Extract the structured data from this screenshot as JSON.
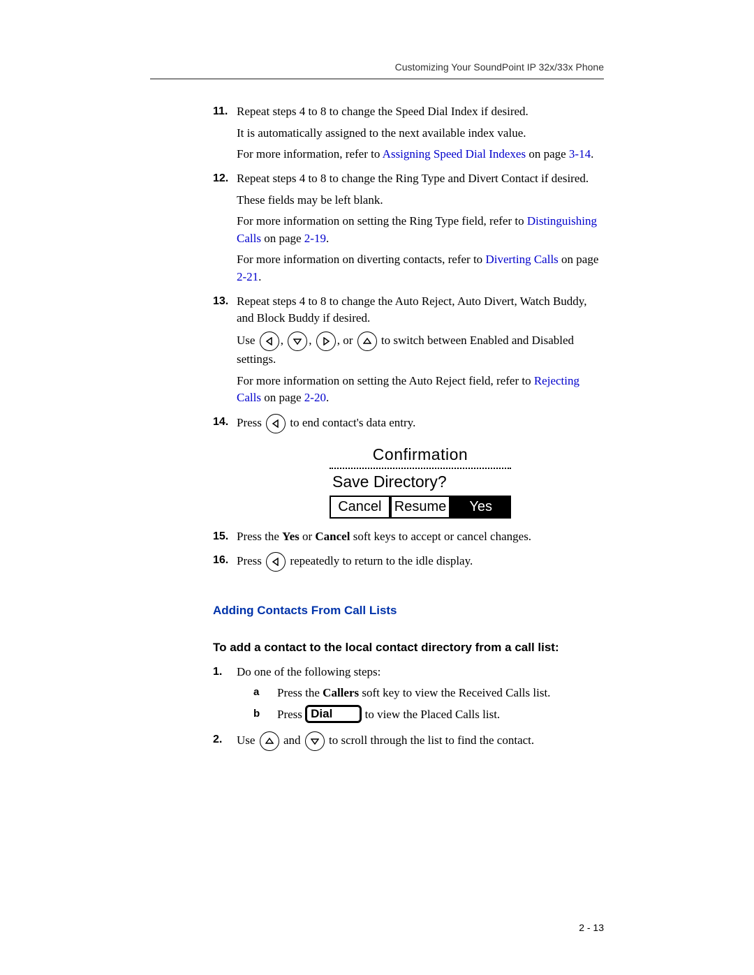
{
  "header": "Customizing Your SoundPoint IP 32x/33x Phone",
  "page_number": "2 - 13",
  "steps": {
    "s11": {
      "num": "11.",
      "p1": "Repeat steps 4 to 8 to change the Speed Dial Index if desired.",
      "p2": "It is automatically assigned to the next available index value.",
      "p3a": "For more information, refer to ",
      "link1": "Assigning Speed Dial Indexes",
      "p3b": " on page ",
      "link1page": "3-14",
      "p3c": "."
    },
    "s12": {
      "num": "12.",
      "p1": "Repeat steps 4 to 8 to change the Ring Type and Divert Contact if desired.",
      "p2": "These fields may be left blank.",
      "p3a": "For more information on setting the Ring Type field, refer to ",
      "link1": "Distinguishing Calls",
      "p3b": " on page ",
      "link1page": "2-19",
      "p3c": ".",
      "p4a": "For more information on diverting contacts, refer to ",
      "link2": "Diverting Calls",
      "p4b": " on page ",
      "link2page": "2-21",
      "p4c": "."
    },
    "s13": {
      "num": "13.",
      "p1": "Repeat steps 4 to 8 to change the Auto Reject, Auto Divert, Watch Buddy, and Block Buddy if desired.",
      "p2a": "Use ",
      "p2b": ", ",
      "p2c": ", ",
      "p2d": ", or ",
      "p2e": " to switch between Enabled and Disabled settings.",
      "p3a": "For more information on setting the Auto Reject field, refer to ",
      "link1": "Rejecting Calls",
      "p3b": " on page ",
      "link1page": "2-20",
      "p3c": "."
    },
    "s14": {
      "num": "14.",
      "p1a": "Press ",
      "p1b": " to end contact's data entry."
    },
    "s15": {
      "num": "15.",
      "p1a": "Press the ",
      "yes": "Yes",
      "p1b": " or ",
      "cancel": "Cancel",
      "p1c": " soft keys to accept or cancel changes."
    },
    "s16": {
      "num": "16.",
      "p1a": "Press ",
      "p1b": " repeatedly to return to the idle display."
    }
  },
  "screen": {
    "title": "Confirmation",
    "line2": "Save Directory?",
    "sk1": "Cancel",
    "sk2": "Resume",
    "sk3": "Yes"
  },
  "section2": {
    "heading": "Adding Contacts From Call Lists",
    "subhead": "To add a contact to the local contact directory from a call list:",
    "s1": {
      "num": "1.",
      "p1": "Do one of the following steps:",
      "a_let": "a",
      "a_p_a": "Press the ",
      "a_callers": "Callers",
      "a_p_b": " soft key to view the Received Calls list.",
      "b_let": "b",
      "b_p_a": "Press ",
      "b_dial": "Dial",
      "b_p_b": " to view the Placed Calls list."
    },
    "s2": {
      "num": "2.",
      "p_a": "Use ",
      "p_b": " and ",
      "p_c": " to scroll through the list to find the contact."
    }
  }
}
